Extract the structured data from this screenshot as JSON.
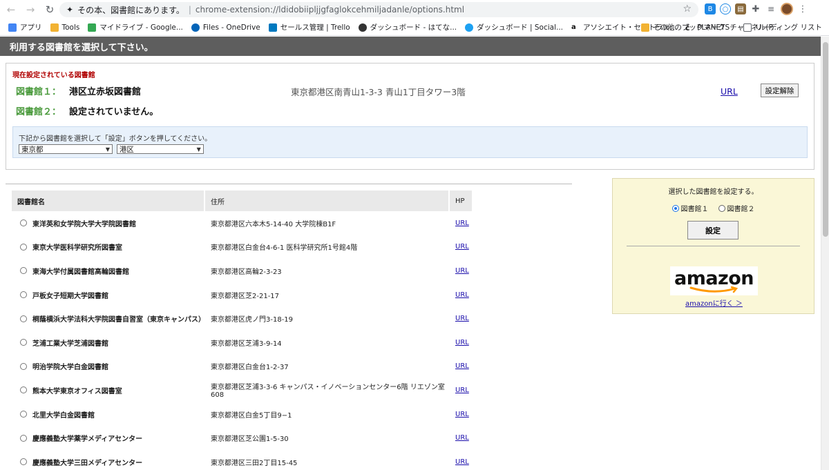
{
  "browser": {
    "omnibox_title": "その本、図書館にあります。",
    "omnibox_url": "chrome-extension://ldidobiipljjgfaglokcehmiljadanle/options.html",
    "bookmarks": [
      {
        "label": "アプリ",
        "icon": "apps-grid-icon",
        "color": "#4285f4"
      },
      {
        "label": "Tools",
        "icon": "folder-icon",
        "color": "#f2b233"
      },
      {
        "label": "マイドライブ - Google...",
        "icon": "google-drive-icon",
        "color": "#34a853"
      },
      {
        "label": "Files - OneDrive",
        "icon": "onedrive-icon",
        "color": "#0364b8"
      },
      {
        "label": "セールス管理 | Trello",
        "icon": "trello-icon",
        "color": "#0079bf"
      },
      {
        "label": "ダッシュボード - はてな...",
        "icon": "hatena-icon",
        "color": "#333333"
      },
      {
        "label": "ダッシュボード | Social...",
        "icon": "social-icon",
        "color": "#1da1f2"
      },
      {
        "label": "アソシエイト・セントラル...",
        "icon": "amazon-icon",
        "color": "#111111"
      },
      {
        "label": "PLANETSチャンネル(P...",
        "icon": "niconico-icon",
        "color": "#111111"
      }
    ],
    "bookmarks_right": [
      {
        "label": "その他のブックマーク",
        "icon": "folder-icon"
      },
      {
        "label": "リーディング リスト",
        "icon": "reading-list-icon"
      }
    ]
  },
  "page": {
    "header": "利用する図書館を選択して下さい。",
    "current_label": "現在設定されている図書館",
    "lib1_num": "図書館１：",
    "lib1_name": "港区立赤坂図書館",
    "lib1_address": "東京都港区南青山1-3-3 青山1丁目タワー3階",
    "lib1_url": "URL",
    "unset_button": "設定解除",
    "lib2_num": "図書館２：",
    "lib2_name": "設定されていません。",
    "select_hint": "下記から図書館を選択して「設定」ボタンを押してください。",
    "pref_select": "東京都",
    "city_select": "港区"
  },
  "table": {
    "headers": {
      "name": "図書館名",
      "address": "住所",
      "hp": "HP"
    },
    "rows": [
      {
        "name": "東洋英和女学院大学大学院図書館",
        "address": "東京都港区六本木5-14-40 大学院棟B1F",
        "hp": "URL"
      },
      {
        "name": "東京大学医科学研究所図書室",
        "address": "東京都港区白金台4-6-1 医科学研究所1号館4階",
        "hp": "URL"
      },
      {
        "name": "東海大学付属図書館高輪図書館",
        "address": "東京都港区高輪2-3-23",
        "hp": "URL"
      },
      {
        "name": "戸板女子短期大学図書館",
        "address": "東京都港区芝2-21-17",
        "hp": "URL"
      },
      {
        "name": "桐蔭横浜大学法科大学院図書自習室（東京キャンパス）",
        "address": "東京都港区虎ノ門3-18-19",
        "hp": "URL"
      },
      {
        "name": "芝浦工業大学芝浦図書館",
        "address": "東京都港区芝浦3-9-14",
        "hp": "URL"
      },
      {
        "name": "明治学院大学白金図書館",
        "address": "東京都港区白金台1-2-37",
        "hp": "URL"
      },
      {
        "name": "熊本大学東京オフィス図書室",
        "address": "東京都港区芝浦3-3-6 キャンパス・イノベーションセンター6階 リエゾン室608",
        "hp": "URL"
      },
      {
        "name": "北里大学白金図書館",
        "address": "東京都港区白金5丁目9−1",
        "hp": "URL"
      },
      {
        "name": "慶應義塾大学薬学メディアセンター",
        "address": "東京都港区芝公園1-5-30",
        "hp": "URL"
      },
      {
        "name": "慶應義塾大学三田メディアセンター",
        "address": "東京都港区三田2丁目15-45",
        "hp": "URL"
      }
    ]
  },
  "side": {
    "title": "選択した図書館を設定する。",
    "radio1": "図書館１",
    "radio2": "図書館２",
    "set_button": "設定",
    "amazon_logo": "amazon",
    "amazon_link": "amazonに行く ＞"
  }
}
